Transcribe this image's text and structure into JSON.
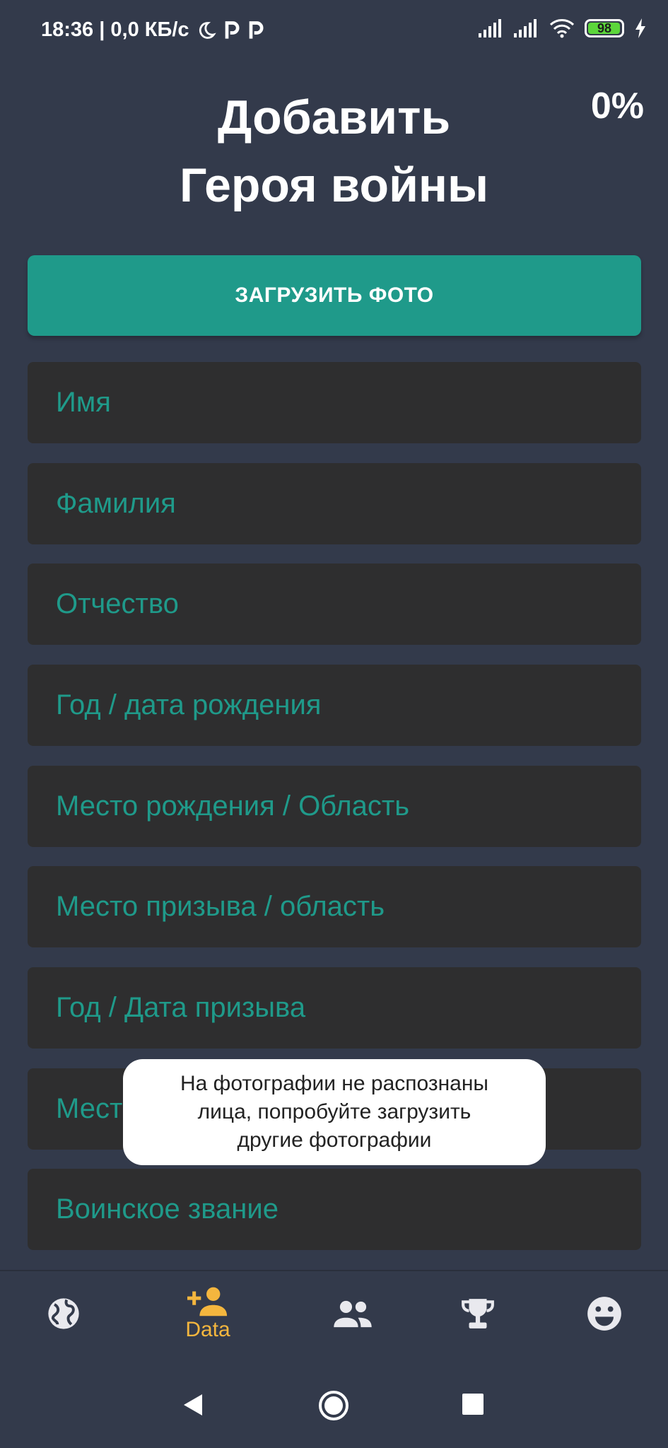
{
  "status_bar": {
    "time_and_speed": "18:36 | 0,0 КБ/с",
    "battery_level": "98",
    "battery_fraction": 0.98,
    "icons": [
      "moon-icon",
      "parking-icon",
      "parking-icon",
      "signal-icon",
      "signal-icon",
      "wifi-icon",
      "battery-icon",
      "charging-icon"
    ]
  },
  "header": {
    "title_line1": "Добавить",
    "title_line2": "Героя войны",
    "progress": "0%"
  },
  "upload_button": {
    "label": "ЗАГРУЗИТЬ ФОТО"
  },
  "form": {
    "fields": [
      {
        "placeholder": "Имя"
      },
      {
        "placeholder": "Фамилия"
      },
      {
        "placeholder": "Отчество"
      },
      {
        "placeholder": "Год / дата рождения"
      },
      {
        "placeholder": "Место рождения / Область"
      },
      {
        "placeholder": "Место призыва / область"
      },
      {
        "placeholder": "Год / Дата призыва"
      },
      {
        "placeholder": "Мест"
      },
      {
        "placeholder": "Воинское звание"
      }
    ]
  },
  "toast": {
    "line1": "На фотографии не распознаны",
    "line2": "лица, попробуйте загрузить",
    "line3": "другие фотографии"
  },
  "bottom_nav": {
    "items": [
      {
        "icon": "globe-icon",
        "label": "",
        "active": false
      },
      {
        "icon": "add-person-icon",
        "label": "Data",
        "active": true
      },
      {
        "icon": "people-icon",
        "label": "",
        "active": false
      },
      {
        "icon": "trophy-icon",
        "label": "",
        "active": false
      },
      {
        "icon": "smiley-icon",
        "label": "",
        "active": false
      }
    ]
  },
  "colors": {
    "background": "#333a4b",
    "accent": "#1f9a8a",
    "field_bg": "#2e2e2f",
    "nav_active": "#f4b63e",
    "nav_inactive": "#e9e9ee"
  }
}
